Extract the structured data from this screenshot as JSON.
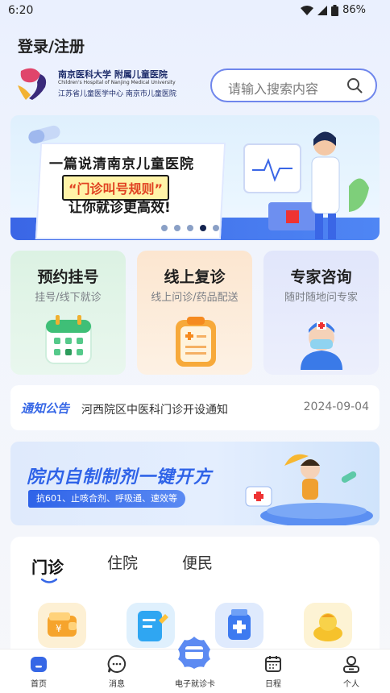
{
  "status_bar": {
    "time": "6:20",
    "battery": "86%"
  },
  "header": {
    "login_label": "登录/注册"
  },
  "hospital": {
    "name_cn": "南京医科大学 附属儿童医院",
    "name_en": "Children's Hospital of Nanjing Medical University",
    "subtitle": "江苏省儿童医学中心  南京市儿童医院"
  },
  "search": {
    "placeholder": "请输入搜索内容"
  },
  "banner": {
    "line1": "一篇说清南京儿童医院",
    "line2": "“门诊叫号规则”",
    "line3": "让你就诊更高效!",
    "dot_count": 5,
    "active_dot": 3
  },
  "cards": [
    {
      "title": "预约挂号",
      "subtitle": "挂号/线下就诊",
      "icon": "calendar-icon"
    },
    {
      "title": "线上复诊",
      "subtitle": "线上问诊/药品配送",
      "icon": "clipboard-icon"
    },
    {
      "title": "专家咨询",
      "subtitle": "随时随地问专家",
      "icon": "doctor-icon"
    }
  ],
  "notice": {
    "tag": "通知公告",
    "text": "河西院区中医科门诊开设通知",
    "date": "2024-09-04"
  },
  "promo": {
    "title": "院内自制制剂一键开方",
    "tag": "抗601、止咳合剂、呼吸通、速效等"
  },
  "services": {
    "tabs": [
      {
        "label": "门诊",
        "active": true
      },
      {
        "label": "住院",
        "active": false
      },
      {
        "label": "便民",
        "active": false
      }
    ],
    "icons": [
      "wallet-icon",
      "report-icon",
      "medicine-icon",
      "duck-icon"
    ]
  },
  "tabbar": {
    "items": [
      {
        "label": "首页",
        "icon": "home-icon",
        "active": true
      },
      {
        "label": "消息",
        "icon": "message-icon",
        "active": false
      },
      {
        "label": "电子就诊卡",
        "icon": "card-icon",
        "active": false
      },
      {
        "label": "日程",
        "icon": "calendar-icon",
        "active": false
      },
      {
        "label": "个人",
        "icon": "person-icon",
        "active": false
      }
    ]
  },
  "colors": {
    "primary": "#3667e6",
    "search_border": "#6f86ec",
    "card_green": "#dcf2e3",
    "card_orange": "#fce6d0",
    "card_blue": "#e1e6fb"
  }
}
